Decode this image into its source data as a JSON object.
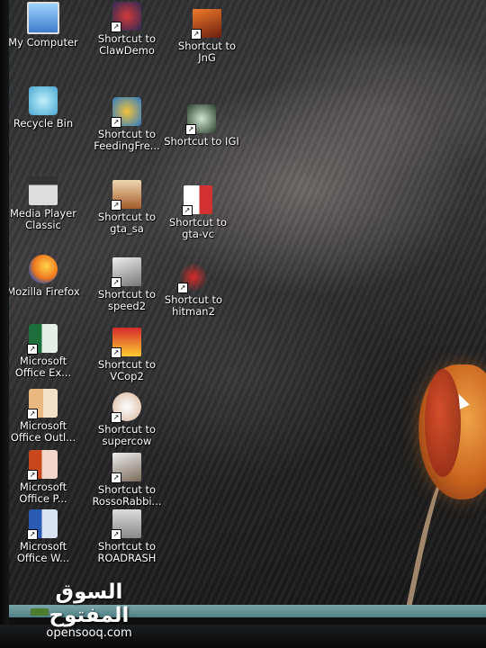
{
  "desktop": {
    "col1": [
      {
        "label": "My Computer",
        "icon": "my-computer-icon"
      },
      {
        "label": "Recycle Bin",
        "icon": "recycle-bin-icon"
      },
      {
        "label": "Media Player\nClassic",
        "icon": "media-player-icon"
      },
      {
        "label": "Mozilla Firefox",
        "icon": "firefox-icon"
      },
      {
        "label": "Microsoft\nOffice Ex...",
        "icon": "excel-icon"
      },
      {
        "label": "Microsoft\nOffice Outl...",
        "icon": "outlook-icon"
      },
      {
        "label": "Microsoft\nOffice P...",
        "icon": "powerpoint-icon"
      },
      {
        "label": "Microsoft\nOffice W...",
        "icon": "word-icon"
      }
    ],
    "col2": [
      {
        "label": "Shortcut to\nClawDemo",
        "icon": "clawdemo-icon"
      },
      {
        "label": "Shortcut to\nFeedingFre...",
        "icon": "feedingfrenzy-icon"
      },
      {
        "label": "Shortcut to\ngta_sa",
        "icon": "gta-sa-icon"
      },
      {
        "label": "Shortcut to\nspeed2",
        "icon": "speed2-icon"
      },
      {
        "label": "Shortcut to\nVCop2",
        "icon": "vcop2-icon"
      },
      {
        "label": "Shortcut to\nsupercow",
        "icon": "supercow-icon"
      },
      {
        "label": "Shortcut to\nRossoRabbi...",
        "icon": "rossorabbit-icon"
      },
      {
        "label": "Shortcut to\nROADRASH",
        "icon": "roadrash-icon"
      }
    ],
    "col3": [
      {
        "label": "Shortcut to\nJnG",
        "icon": "jng-icon"
      },
      {
        "label": "Shortcut to IGI",
        "icon": "igi-icon"
      },
      {
        "label": "Shortcut to\ngta-vc",
        "icon": "gta-vc-icon"
      },
      {
        "label": "Shortcut to\nhitman2",
        "icon": "hitman2-icon"
      }
    ]
  },
  "watermark": {
    "arabic": "السوق المفتوح",
    "latin": "opensooq.com"
  }
}
